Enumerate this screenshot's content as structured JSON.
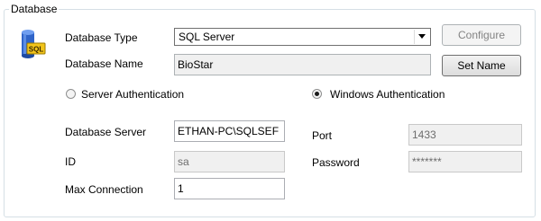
{
  "group": {
    "title": "Database"
  },
  "db_type": {
    "label": "Database Type",
    "value": "SQL Server"
  },
  "db_name": {
    "label": "Database Name",
    "value": "BioStar"
  },
  "buttons": {
    "configure": "Configure",
    "set_name": "Set Name"
  },
  "auth": {
    "server": {
      "label": "Server Authentication",
      "selected": false
    },
    "windows": {
      "label": "Windows Authentication",
      "selected": true
    }
  },
  "server": {
    "label": "Database Server",
    "value": "ETHAN-PC\\SQLSEF"
  },
  "port": {
    "label": "Port",
    "value": "1433"
  },
  "id": {
    "label": "ID",
    "value": "sa"
  },
  "password": {
    "label": "Password",
    "value": "*******"
  },
  "max_connection": {
    "label": "Max Connection",
    "value": "1"
  },
  "icon": {
    "name": "database-icon",
    "text": "SQL"
  }
}
